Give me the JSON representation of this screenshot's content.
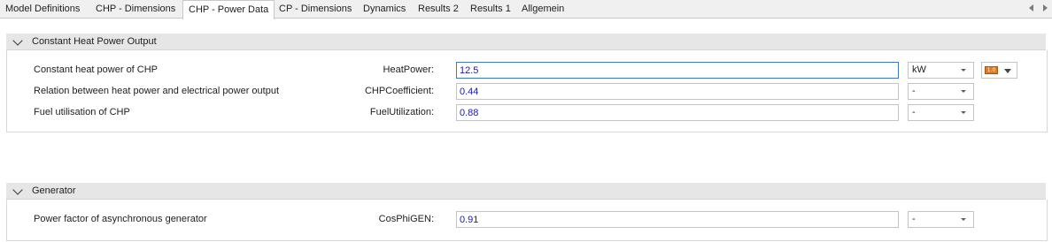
{
  "tabs": [
    {
      "label": "Model Definitions"
    },
    {
      "label": "CHP - Dimensions"
    },
    {
      "label": "CHP - Power Data"
    },
    {
      "label": "CP - Dimensions"
    },
    {
      "label": "Dynamics"
    },
    {
      "label": "Results 2"
    },
    {
      "label": "Results 1"
    },
    {
      "label": "Allgemein"
    }
  ],
  "active_tab": "CHP - Power Data",
  "sections": {
    "heat_power": {
      "title": "Constant Heat Power Output",
      "rows": [
        {
          "label": "Constant heat power of CHP",
          "param": "HeatPower:",
          "value": "12.5",
          "unit": "kW"
        },
        {
          "label": "Relation between heat power and electrical power output",
          "param": "CHPCoefficient:",
          "value": "0.44",
          "unit": "-"
        },
        {
          "label": "Fuel utilisation of CHP",
          "param": "FuelUtilization:",
          "value": "0.88",
          "unit": "-"
        }
      ],
      "version_badge": "1.0"
    },
    "generator": {
      "title": "Generator",
      "rows": [
        {
          "label": "Power factor of asynchronous generator",
          "param": "CosPhiGEN:",
          "value": "0.91",
          "unit": "-"
        }
      ]
    }
  },
  "colors": {
    "value_text": "#1a1ab0",
    "focus_border": "#3a78c8",
    "section_header": "#e6e6e6",
    "badge": "#e07b24"
  }
}
